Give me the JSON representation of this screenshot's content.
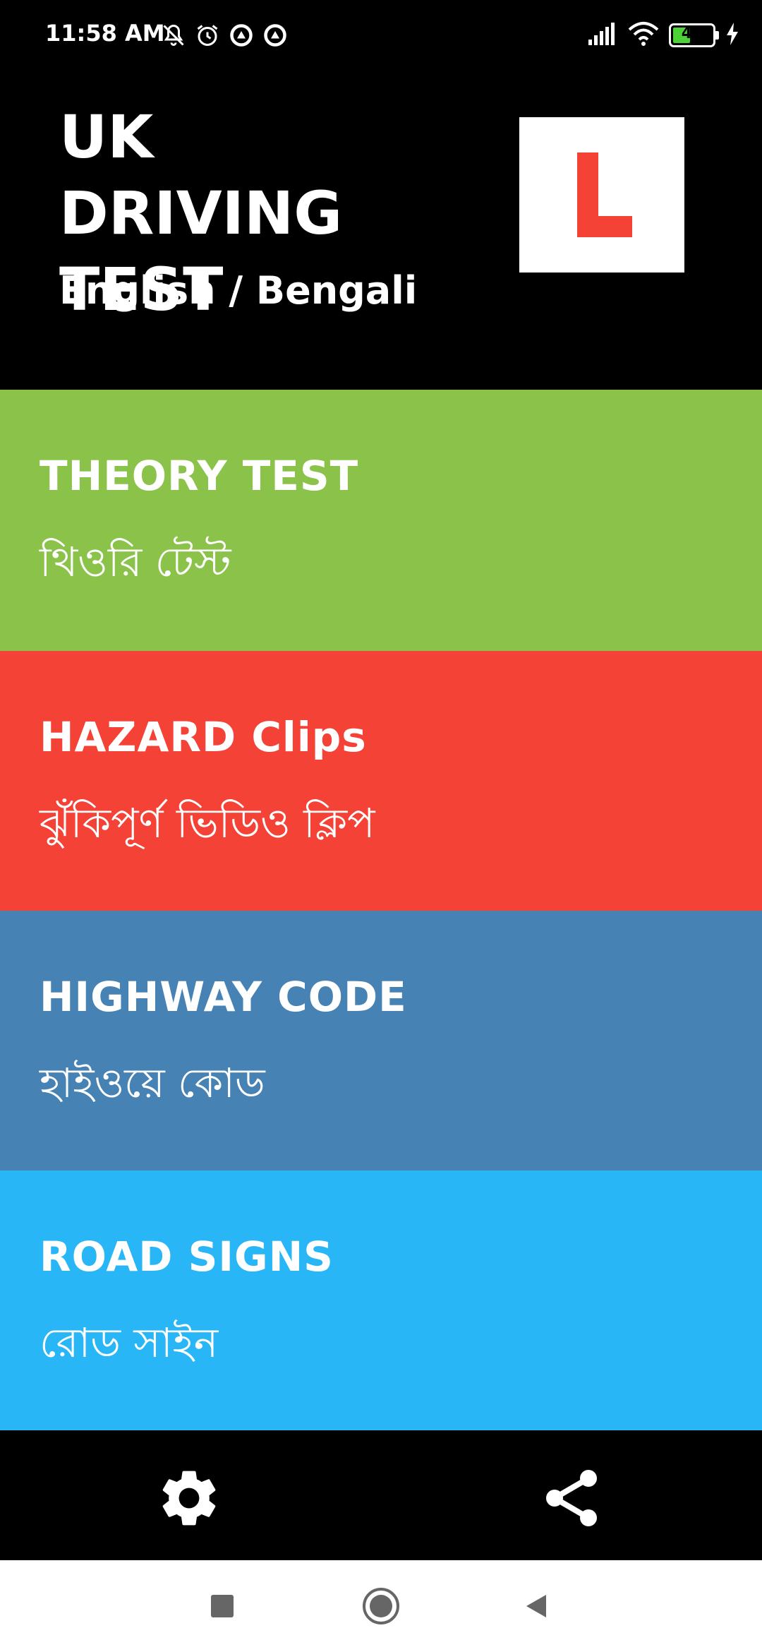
{
  "status_bar": {
    "time": "11:58 AM",
    "battery_level": "45",
    "battery_fraction": 0.45,
    "left_icons": [
      "mute-icon",
      "alarm-icon",
      "data-saver-icon",
      "data-saver-icon"
    ],
    "right_icons": [
      "signal-icon",
      "wifi-icon",
      "battery-icon",
      "charging-icon"
    ]
  },
  "header": {
    "title": "UK DRIVING TEST",
    "subtitle": "English / Bengali",
    "logo_letter": "L",
    "logo_color": "#f44336"
  },
  "menu": [
    {
      "label_en": "THEORY TEST",
      "label_bn": "থিওরি টেস্ট",
      "color": "#8bc34a"
    },
    {
      "label_en": "HAZARD Clips",
      "label_bn": "ঝুঁকিপূর্ণ ভিডিও ক্লিপ",
      "color": "#f44336"
    },
    {
      "label_en": "HIGHWAY CODE",
      "label_bn": "হাইওয়ে কোড",
      "color": "#4682b4"
    },
    {
      "label_en": "ROAD SIGNS",
      "label_bn": "রোড সাইন",
      "color": "#29b6f6"
    }
  ],
  "toolbar": {
    "settings_icon": "gear-icon",
    "share_icon": "share-icon"
  },
  "nav_bar": {
    "buttons": [
      "recents-square-icon",
      "home-circle-icon",
      "back-triangle-icon"
    ]
  }
}
